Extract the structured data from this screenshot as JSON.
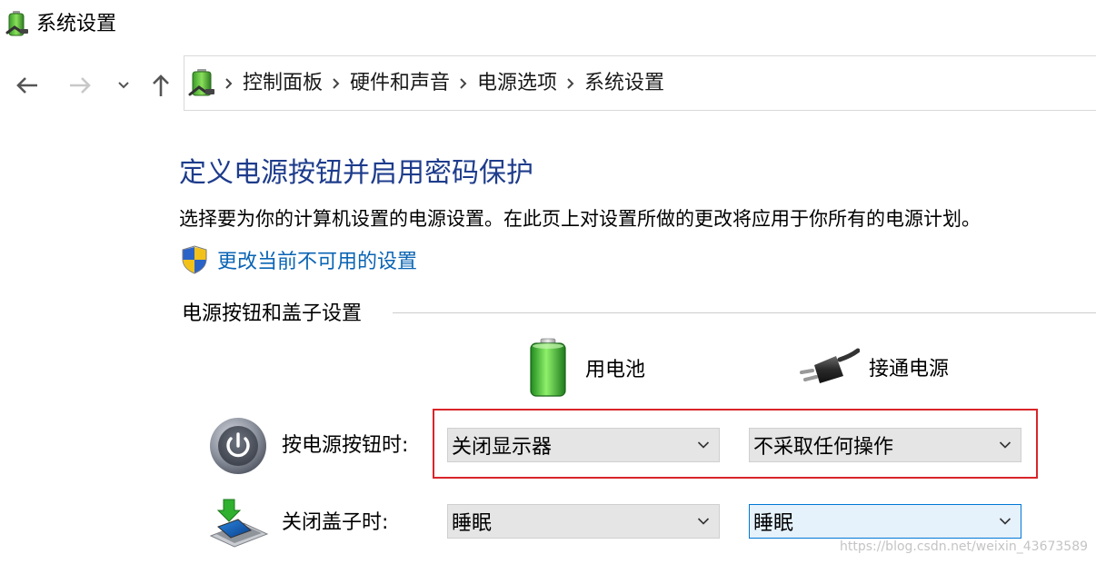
{
  "window": {
    "title": "系统设置"
  },
  "breadcrumb": [
    "控制面板",
    "硬件和声音",
    "电源选项",
    "系统设置"
  ],
  "page": {
    "title": "定义电源按钮并启用密码保护",
    "description": "选择要为你的计算机设置的电源设置。在此页上对设置所做的更改将应用于你所有的电源计划。",
    "change_link": "更改当前不可用的设置"
  },
  "section": {
    "header": "电源按钮和盖子设置",
    "columns": {
      "battery": "用电池",
      "ac": "接通电源"
    },
    "rows": {
      "power_button": {
        "label": "按电源按钮时:",
        "battery": "关闭显示器",
        "ac": "不采取任何操作"
      },
      "lid": {
        "label": "关闭盖子时:",
        "battery": "睡眠",
        "ac": "睡眠"
      }
    }
  },
  "watermark": "https://blog.csdn.net/weixin_43673589",
  "colors": {
    "title": "#1e3c8c",
    "link": "#0a64b4",
    "highlight": "#d9252a",
    "focus": "#0078d7"
  },
  "icons": {
    "window": "power-options-icon",
    "back": "arrow-left-icon",
    "forward": "arrow-right-icon",
    "recent": "chevron-down-icon",
    "up": "arrow-up-icon",
    "shield": "uac-shield-icon",
    "battery": "battery-icon",
    "plug": "plug-icon",
    "power_button": "power-button-icon",
    "lid": "laptop-lid-icon"
  }
}
